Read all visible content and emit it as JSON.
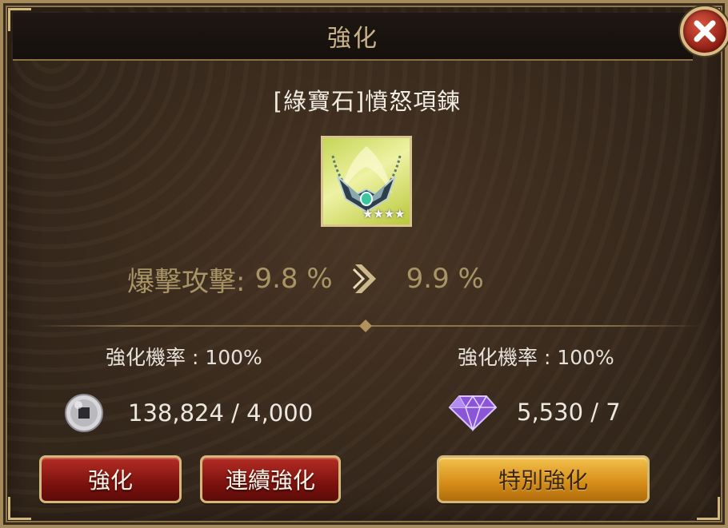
{
  "dialog": {
    "title": "強化"
  },
  "item": {
    "name": "[綠寶石]憤怒項鍊",
    "stars": "★★★★"
  },
  "stat": {
    "label": "爆擊攻擊:",
    "current": "9.8 %",
    "next": "9.9 %"
  },
  "left": {
    "rate": "強化機率 : 100%",
    "cost": "138,824 / 4,000"
  },
  "right": {
    "rate": "強化機率 : 100%",
    "cost": "5,530 / 7"
  },
  "buttons": {
    "enhance": "強化",
    "continuous": "連續強化",
    "special": "特別強化"
  },
  "colors": {
    "accent_gold": "#d3b979",
    "button_red": "#7d120e",
    "button_gold": "#d58c17",
    "gem_purple": "#8a55d8"
  }
}
